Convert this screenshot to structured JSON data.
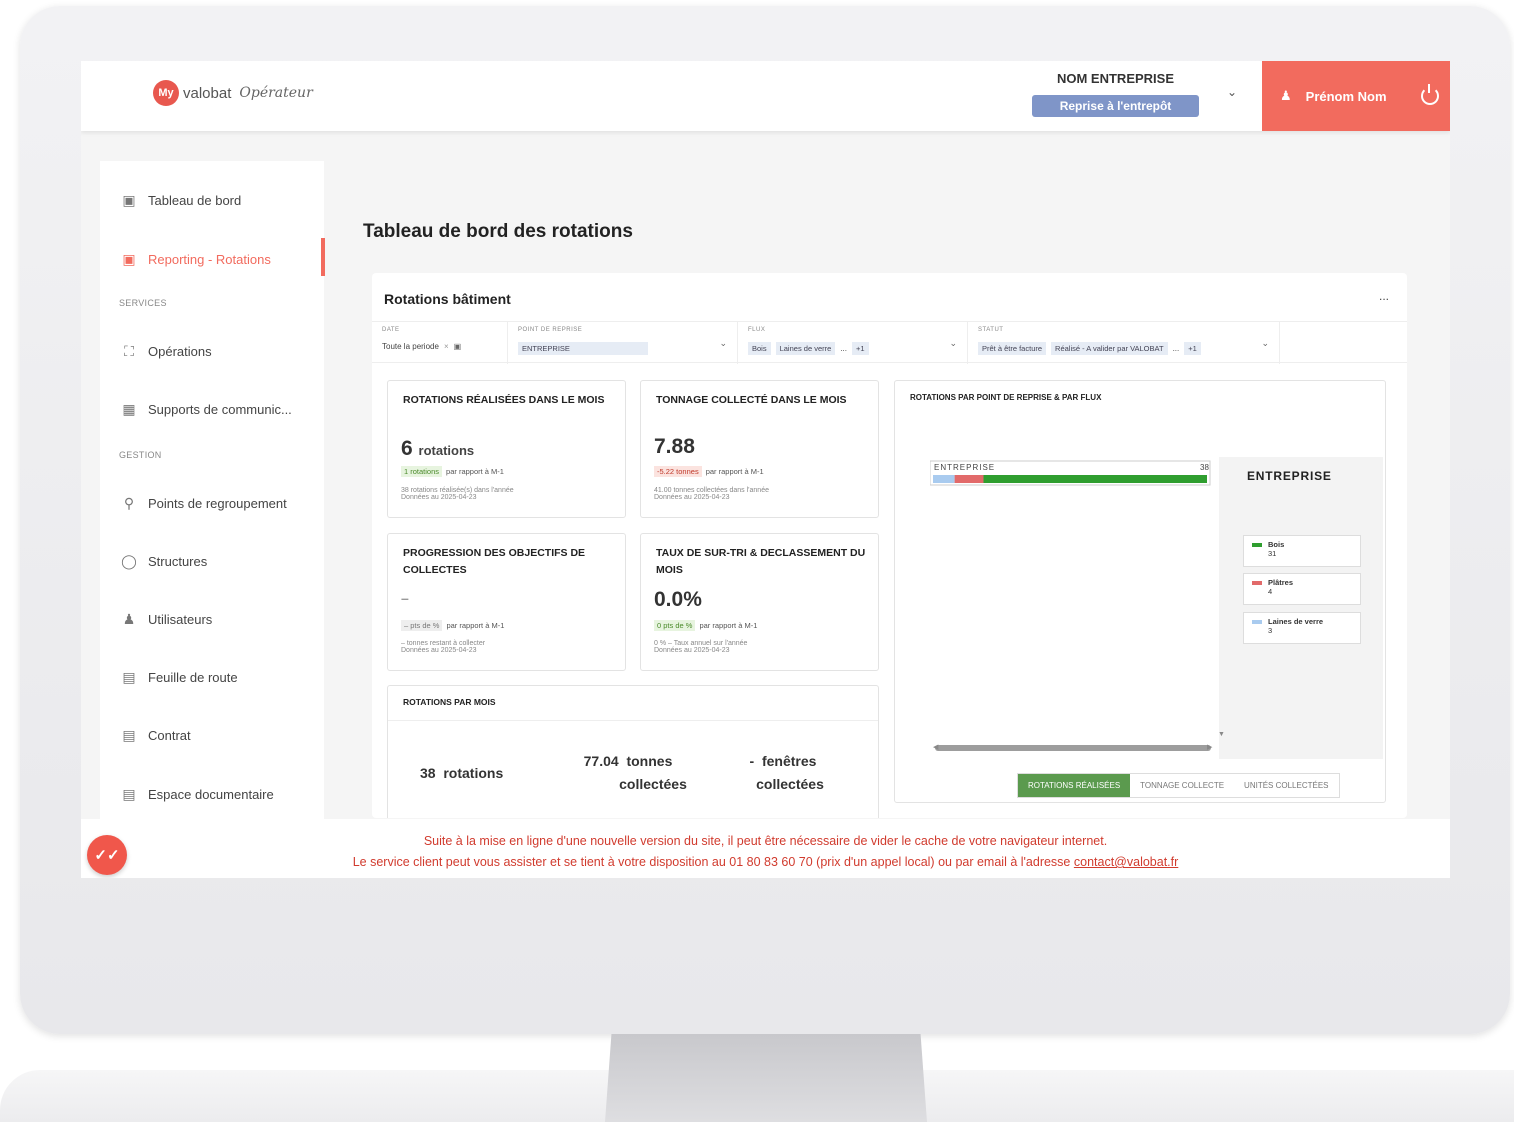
{
  "brand": {
    "badge": "My",
    "word": "valobat",
    "sub": "Opérateur"
  },
  "company": {
    "name": "NOM ENTREPRISE",
    "mode": "Reprise à l'entrepôt"
  },
  "user": {
    "name": "Prénom Nom"
  },
  "sidebar": {
    "items": [
      {
        "label": "Tableau de bord",
        "icon": "monitor-icon"
      },
      {
        "label": "Reporting - Rotations",
        "icon": "chart-monitor-icon",
        "active": true
      },
      {
        "label": "Opérations",
        "icon": "truck-icon"
      },
      {
        "label": "Supports de communic...",
        "icon": "board-icon"
      },
      {
        "label": "Points de regroupement",
        "icon": "map-pin-icon"
      },
      {
        "label": "Structures",
        "icon": "building-icon"
      },
      {
        "label": "Utilisateurs",
        "icon": "users-icon"
      },
      {
        "label": "Feuille de route",
        "icon": "route-sheet-icon"
      },
      {
        "label": "Contrat",
        "icon": "contract-icon"
      },
      {
        "label": "Espace documentaire",
        "icon": "document-icon"
      }
    ],
    "sections": {
      "services": "SERVICES",
      "gestion": "GESTION"
    }
  },
  "page": {
    "title": "Tableau de bord des rotations"
  },
  "panel": {
    "title": "Rotations bâtiment",
    "more": "..."
  },
  "filters": {
    "date": {
      "label": "DATE",
      "value": "Toute la periode"
    },
    "point": {
      "label": "POINT DE REPRISE",
      "value": "ENTREPRISE"
    },
    "flux": {
      "label": "FLUX",
      "chips": [
        "Bois",
        "Laines de verre"
      ],
      "extra": "+1"
    },
    "statut": {
      "label": "STATUT",
      "chips": [
        "Prêt à être facture",
        "Réalisé - A valider par VALOBAT"
      ],
      "extra": "+1"
    }
  },
  "cards": {
    "rotations": {
      "title": "ROTATIONS RÉALISÉES DANS LE MOIS",
      "value": "6",
      "unit": "rotations",
      "delta": "1 rotations",
      "delta_text": "par rapport à M-1",
      "foot1": "38 rotations réalisée(s) dans l'année",
      "foot2": "Données au 2025-04-23"
    },
    "tonnage": {
      "title": "TONNAGE COLLECTÉ DANS LE MOIS",
      "value": "7.88",
      "delta": "-5.22 tonnes",
      "delta_text": "par rapport à M-1",
      "foot1": "41.00 tonnes collectées dans l'année",
      "foot2": "Données au 2025-04-23"
    },
    "progression": {
      "title": "PROGRESSION DES OBJECTIFS DE COLLECTES",
      "value": "–",
      "delta": "– pts de %",
      "delta_text": "par rapport à M-1",
      "foot1": "– tonnes restant à collecter",
      "foot2": "Données au 2025-04-23"
    },
    "surtri": {
      "title": "TAUX DE SUR-TRI & DECLASSEMENT DU MOIS",
      "value": "0.0%",
      "delta": "0 pts de %",
      "delta_text": "par rapport à M-1",
      "foot1": "0 % – Taux annuel sur l'année",
      "foot2": "Données au 2025-04-23"
    }
  },
  "month": {
    "title": "ROTATIONS PAR MOIS",
    "rotations": {
      "value": "38",
      "label": "rotations"
    },
    "tonnes": {
      "value": "77.04",
      "label1": "tonnes",
      "label2": "collectées"
    },
    "fenetres": {
      "value": "-",
      "label1": "fenêtres",
      "label2": "collectées"
    }
  },
  "chart_data": {
    "type": "bar",
    "title": "ROTATIONS PAR POINT DE REPRISE & PAR FLUX",
    "categories": [
      "ENTREPRISE"
    ],
    "stacked": true,
    "orientation": "horizontal",
    "series": [
      {
        "name": "Laines de verre",
        "values": [
          3
        ],
        "color": "#a9cbef"
      },
      {
        "name": "Plâtres",
        "values": [
          4
        ],
        "color": "#e26a6a"
      },
      {
        "name": "Bois",
        "values": [
          31
        ],
        "color": "#2f9e2f"
      }
    ],
    "total_label": "38",
    "legend_title": "ENTREPRISE",
    "legend": [
      {
        "name": "Bois",
        "value": "31",
        "color": "#2f9e2f"
      },
      {
        "name": "Plâtres",
        "value": "4",
        "color": "#e26a6a"
      },
      {
        "name": "Laines de verre",
        "value": "3",
        "color": "#a9cbef"
      }
    ],
    "tabs": [
      "ROTATIONS RÉALISÉES",
      "TONNAGE COLLECTE",
      "UNITÉS COLLECTÉES"
    ],
    "active_tab": "ROTATIONS RÉALISÉES"
  },
  "notice": {
    "line1": "Suite à la mise en ligne d'une nouvelle version du site, il peut être nécessaire de vider le cache de votre navigateur internet.",
    "line2": "Le service client peut vous assister et se tient à votre disposition au 01 80 83 60 70 (prix d'un appel local) ou par email à l'adresse",
    "email": "contact@valobat.fr"
  }
}
